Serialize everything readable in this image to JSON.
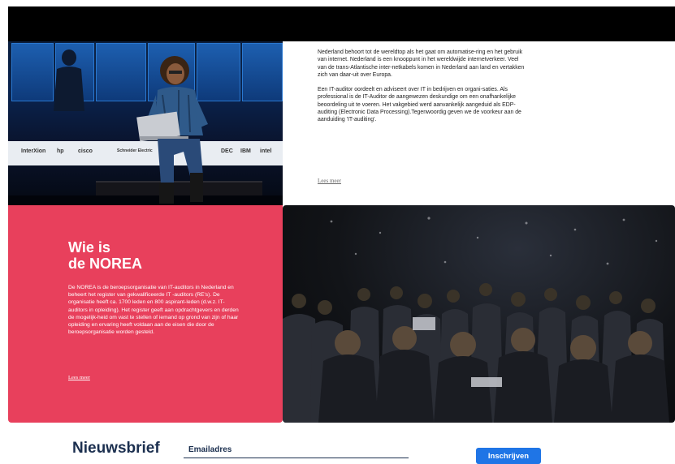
{
  "about": {
    "paragraph1": "Nederland behoort tot de wereldtop als het gaat om automatise-ring en het gebruik van internet. Nederland is een knooppunt in het wereldwijde internetverkeer. Veel van de trans-Atlantische inter-netkabels komen in Nederland aan land en vertakken zich van daar-uit over Europa.",
    "paragraph2": "Een IT-auditor oordeelt en adviseert over IT in bedrijven en organi-saties. Als professional is de IT-Auditor de aangewezen deskundige om een onafhankelijke beoordeling uit te voeren. Het vakgebied werd aanvankelijk aangeduid als EDP-auditing (Electronic Data Processing).Tegenwoordig geven we de voorkeur aan de aanduiding 'IT-auditing'.",
    "read_more": "Lees meer"
  },
  "norea": {
    "title_line1": "Wie is",
    "title_line2": "de NOREA",
    "text": "De NOREA is de beroepsorganisatie van IT-auditors in Nederland en beheert het register van gekwalificeerde IT -auditors (RE's). De organisatie heeft ca. 1700 leden en 800 aspirant-leden (d.w.z. IT-auditors in opleiding). Het register geeft aan opdrachtgevers en derden de mogelijk-heid om vast te stellen of iemand op grond van zijn of haar opleiding en ervaring heeft voldaan aan de eisen die door de beroepsorganisatie worden gesteld.",
    "read_more": "Lees meer"
  },
  "hero_banner": {
    "logos": [
      "InterXion",
      "hp",
      "cisco",
      "Schneider Electric",
      "DEC",
      "IBM",
      "intel"
    ]
  },
  "newsletter": {
    "title": "Nieuwsbrief",
    "email_placeholder": "Emailadres",
    "subscribe_label": "Inschrijven"
  },
  "colors": {
    "accent_red": "#e8405c",
    "button_blue": "#1f75e6",
    "navy": "#1b2f4f"
  }
}
